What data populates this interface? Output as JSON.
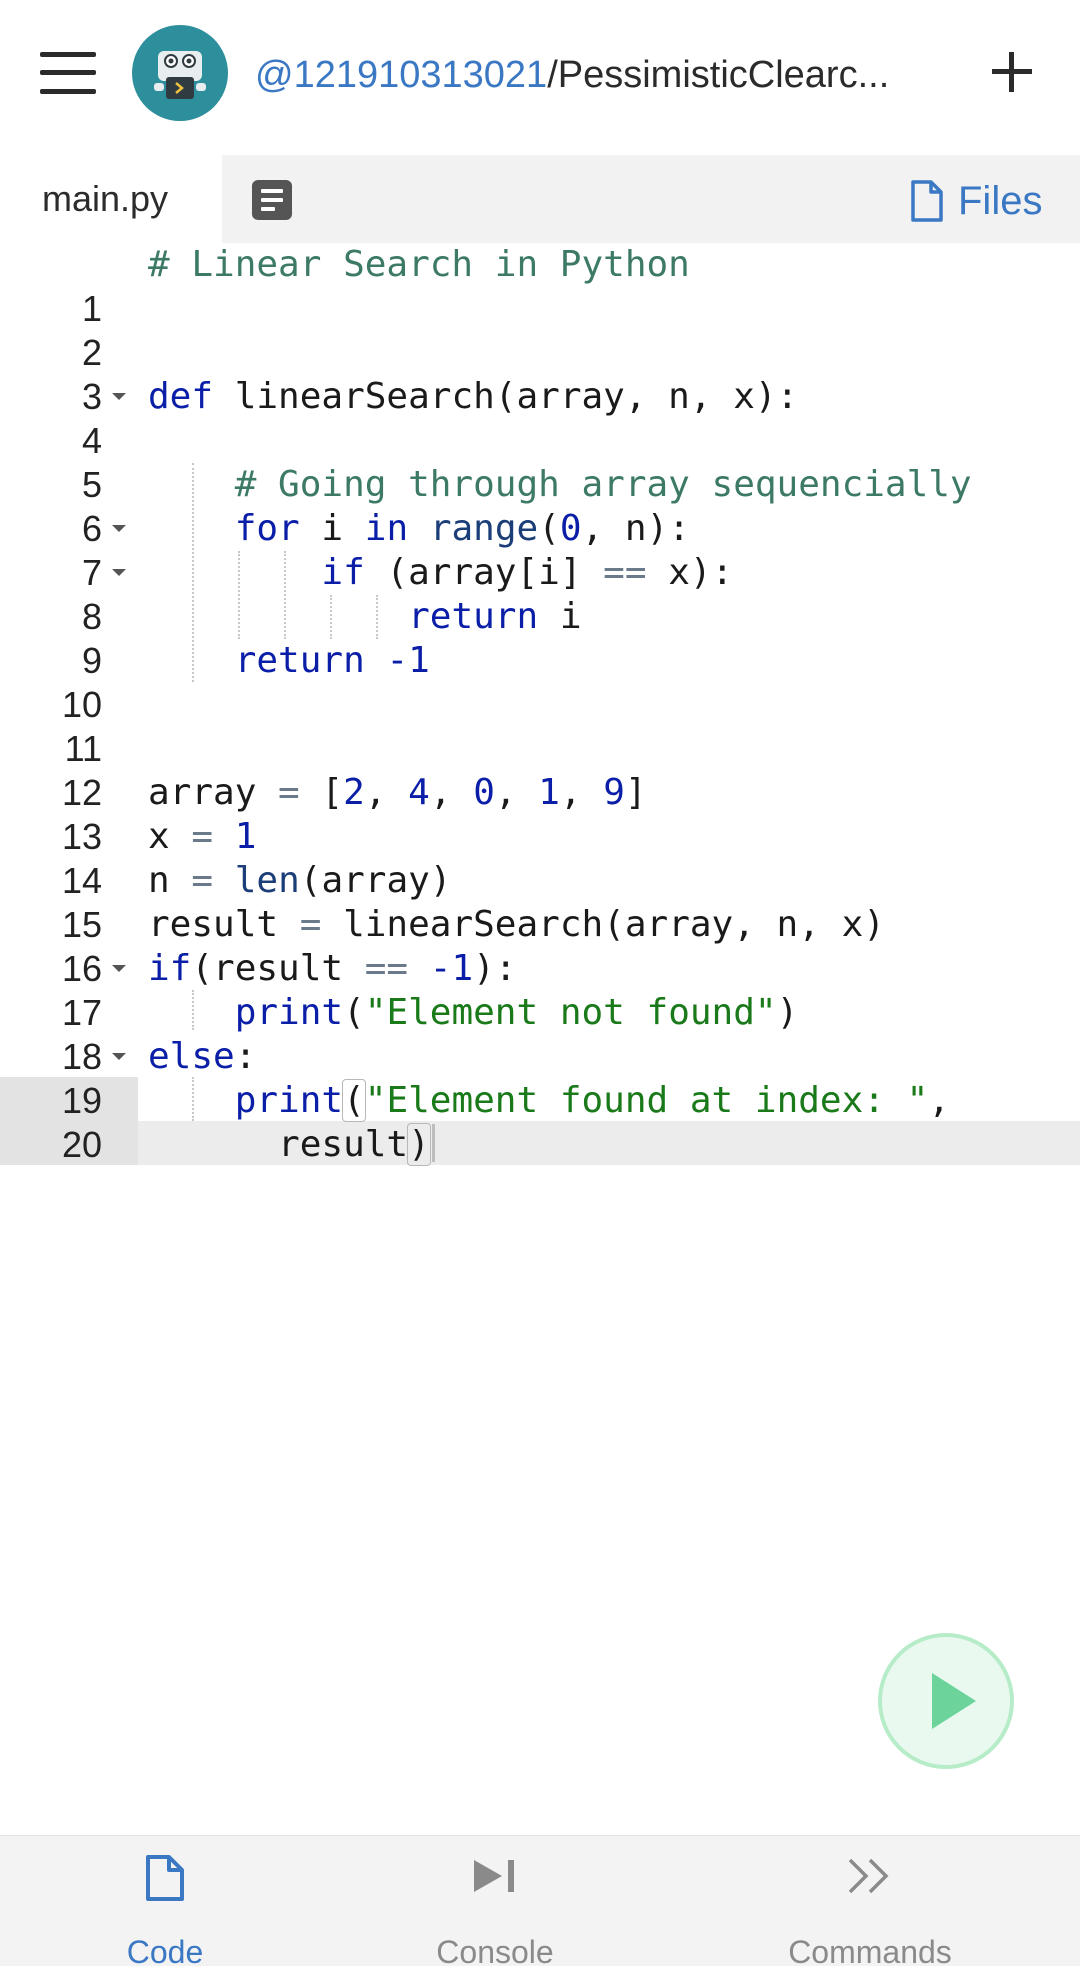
{
  "header": {
    "repo_owner": "@121910313021",
    "repo_separator": "/",
    "repo_name": "PessimisticClearc...",
    "menu_icon": "hamburger-menu-icon",
    "add_icon": "plus-icon"
  },
  "tabs": {
    "active_file": "main.py",
    "files_label": "Files"
  },
  "editor": {
    "line_numbers": [
      "1",
      "2",
      "3",
      "4",
      "5",
      "6",
      "7",
      "8",
      "9",
      "10",
      "11",
      "12",
      "13",
      "14",
      "15",
      "16",
      "17",
      "18",
      "19",
      "20"
    ],
    "lines": [
      "# Linear Search in Python",
      "",
      "",
      "def linearSearch(array, n, x):",
      "",
      "    # Going through array sequencially",
      "    for i in range(0, n):",
      "        if (array[i] == x):",
      "            return i",
      "    return -1",
      "",
      "",
      "array = [2, 4, 0, 1, 9]",
      "x = 1",
      "n = len(array)",
      "result = linearSearch(array, n, x)",
      "if(result == -1):",
      "    print(\"Element not found\")",
      "else:",
      "    print(\"Element found at index: \",",
      "      result)"
    ]
  },
  "bottom_nav": {
    "code_label": "Code",
    "console_label": "Console",
    "commands_label": "Commands"
  },
  "colors": {
    "accent_blue": "#3b78c4",
    "run_green": "#6cd39a",
    "keyword": "#0a1ea8",
    "comment": "#3c7a66",
    "string": "#1a7a1a"
  }
}
